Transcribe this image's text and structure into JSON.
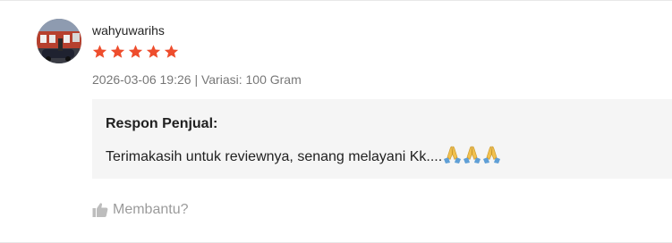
{
  "review": {
    "reviewer_name": "wahyuwarihs",
    "rating": 5,
    "rating_max": 5,
    "date": "2026-03-06 19:26",
    "separator": "|",
    "variation": "Variasi: 100 Gram",
    "seller_response": {
      "title": "Respon Penjual:",
      "text": "Terimakasih untuk reviewnya, senang melayani Kk....",
      "emoji_count": 3,
      "emoji_icon": "folded-hands-icon"
    },
    "helpful_label": "Membantu?",
    "helpful_icon": "thumbs-up-icon"
  },
  "colors": {
    "star": "#ee4d2d",
    "response_background": "#f5f5f5",
    "muted_text": "#8a8a8a"
  }
}
